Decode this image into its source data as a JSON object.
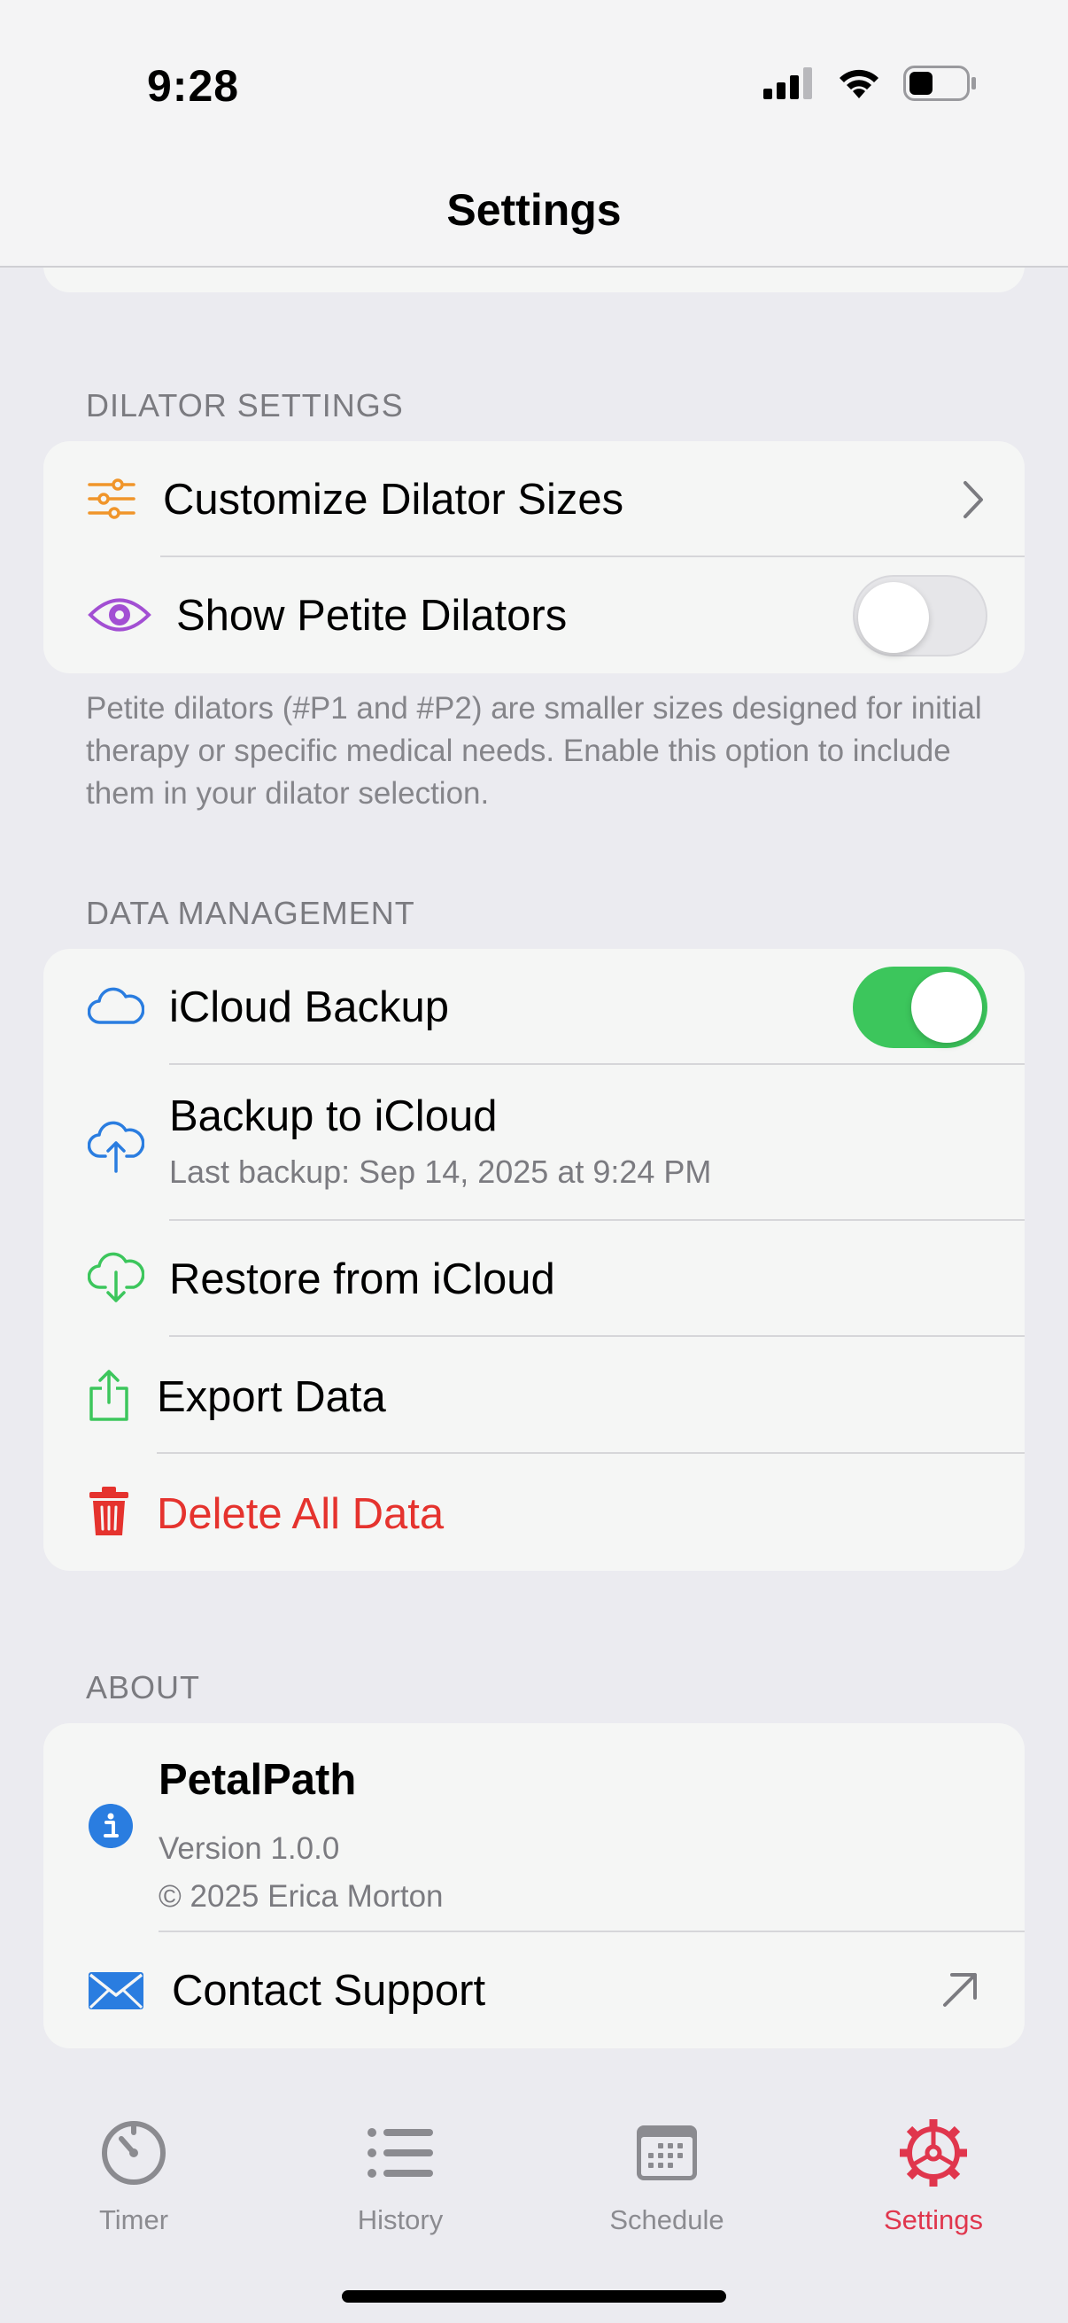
{
  "status_bar": {
    "time": "9:28"
  },
  "nav": {
    "title": "Settings"
  },
  "dilator_settings": {
    "header": "DILATOR SETTINGS",
    "customize_label": "Customize Dilator Sizes",
    "petite_label": "Show Petite Dilators",
    "petite_enabled": false,
    "footer": "Petite dilators (#P1 and #P2) are smaller sizes designed for initial therapy or specific medical needs. Enable this option to include them in your dilator selection."
  },
  "data_management": {
    "header": "DATA MANAGEMENT",
    "icloud_backup_label": "iCloud Backup",
    "icloud_backup_enabled": true,
    "backup_label": "Backup to iCloud",
    "backup_sublabel": "Last backup: Sep 14, 2025 at 9:24 PM",
    "restore_label": "Restore from iCloud",
    "export_label": "Export Data",
    "delete_label": "Delete All Data"
  },
  "about": {
    "header": "ABOUT",
    "app_name": "PetalPath",
    "version": "Version 1.0.0",
    "copyright": "© 2025 Erica Morton",
    "contact_label": "Contact Support"
  },
  "tabs": [
    {
      "label": "Timer",
      "icon": "timer-icon",
      "active": false
    },
    {
      "label": "History",
      "icon": "list-icon",
      "active": false
    },
    {
      "label": "Schedule",
      "icon": "calendar-icon",
      "active": false
    },
    {
      "label": "Settings",
      "icon": "gear-icon",
      "active": true
    }
  ],
  "colors": {
    "accent_orange": "#f0952a",
    "accent_purple": "#a24fd3",
    "accent_blue": "#2a7de0",
    "accent_green": "#3cc65c",
    "destructive_red": "#e5332e",
    "active_tab": "#e0364d"
  }
}
